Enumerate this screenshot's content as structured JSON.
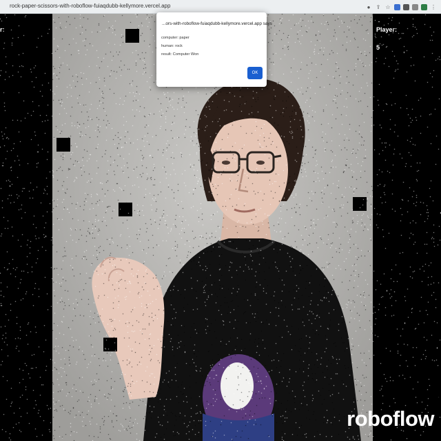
{
  "browser": {
    "url": "rock-paper-scissors-with-roboflow-fuiaqdubb-kellymore.vercel.app",
    "toolbar_icons": [
      "profile-icon",
      "share-icon",
      "bookmark-star-icon",
      "extension-icons",
      "menu-icon"
    ]
  },
  "game": {
    "left_label": "r:",
    "player_label": "Player:",
    "player_score": "5",
    "brand": "roboflow"
  },
  "dialog": {
    "title": "...ors-with-roboflow-fuiaqdubb-kellymore.vercel.app says",
    "lines": [
      "computer: paper",
      "human: rock",
      "result: Computer Won"
    ],
    "ok_label": "OK"
  },
  "colors": {
    "ok_button": "#1a5fd0",
    "wall": "#b9b8b5",
    "background": "#000000"
  }
}
